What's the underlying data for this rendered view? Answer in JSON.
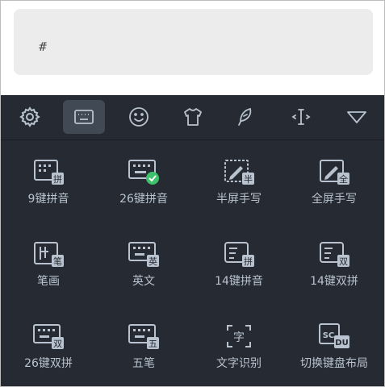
{
  "input": {
    "text": "#̄"
  },
  "toolbar": {
    "items": [
      {
        "name": "settings",
        "icon": "gear-icon"
      },
      {
        "name": "keyboard",
        "icon": "keyboard-icon",
        "active": true
      },
      {
        "name": "emoji",
        "icon": "smiley-icon"
      },
      {
        "name": "skin",
        "icon": "shirt-icon"
      },
      {
        "name": "handwrite",
        "icon": "feather-icon"
      },
      {
        "name": "cursor",
        "icon": "cursor-move-icon"
      },
      {
        "name": "collapse",
        "icon": "triangle-down-icon"
      }
    ]
  },
  "keyboard_options": [
    {
      "label": "9键拼音",
      "badge": "拼"
    },
    {
      "label": "26键拼音",
      "badge": "check"
    },
    {
      "label": "半屏手写",
      "badge": "半"
    },
    {
      "label": "全屏手写",
      "badge": "全"
    },
    {
      "label": "笔画",
      "badge": "笔"
    },
    {
      "label": "英文",
      "badge": "英"
    },
    {
      "label": "14键拼音",
      "badge": "拼"
    },
    {
      "label": "14键双拼",
      "badge": "双"
    },
    {
      "label": "26键双拼",
      "badge": "双"
    },
    {
      "label": "五笔",
      "badge": "五"
    },
    {
      "label": "文字识别",
      "badge": "字"
    },
    {
      "label": "切换键盘布局",
      "badge": "DU"
    }
  ],
  "colors": {
    "keyboard_bg": "#262b33",
    "icon": "#b9c3cf",
    "check": "#3ec16b",
    "active_bg": "#414954"
  }
}
